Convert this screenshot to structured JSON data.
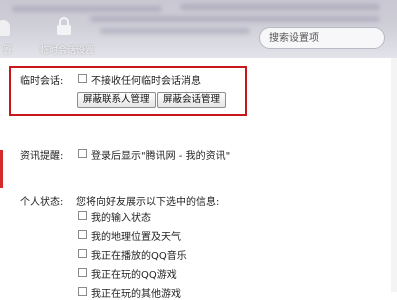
{
  "header": {
    "lock_label": "临时会话设置",
    "left_label": "置"
  },
  "search": {
    "placeholder": "搜索设置项"
  },
  "temp_session": {
    "label": "临时会话:",
    "checkbox_label": "不接收任何临时会话消息",
    "checked": false,
    "buttons": [
      "屏蔽联系人管理",
      "屏蔽会话管理"
    ]
  },
  "news": {
    "label": "资讯提醒:",
    "checkbox_label": "登录后显示\"腾讯网 - 我的资讯\"",
    "checked": false
  },
  "personal_status": {
    "label": "个人状态:",
    "description": "您将向好友展示以下选中的信息:",
    "items": [
      {
        "label": "我的输入状态",
        "checked": false
      },
      {
        "label": "我的地理位置及天气",
        "checked": false
      },
      {
        "label": "我正在播放的QQ音乐",
        "checked": false
      },
      {
        "label": "我正在玩的QQ游戏",
        "checked": false
      },
      {
        "label": "我正在玩的其他游戏",
        "checked": false
      }
    ]
  },
  "colors": {
    "highlight_border": "#c7161c",
    "accent": "#d52a2a"
  }
}
